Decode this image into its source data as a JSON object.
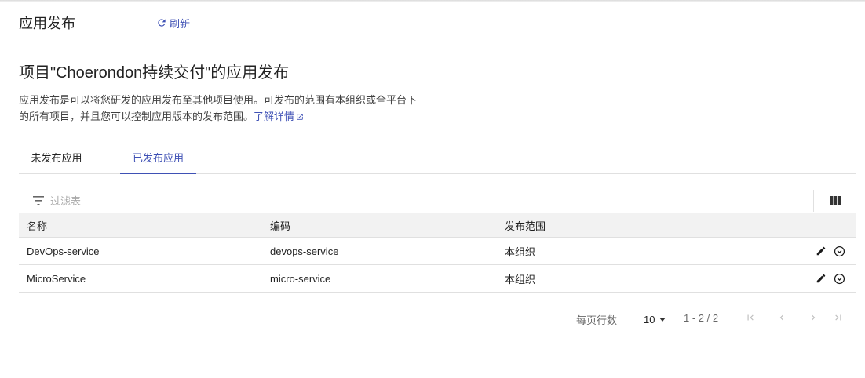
{
  "header": {
    "title": "应用发布",
    "refresh_label": "刷新"
  },
  "intro": {
    "title": "项目\"Choerondon持续交付\"的应用发布",
    "description_line1": "应用发布是可以将您研发的应用发布至其他项目使用。可发布的范围有本组织或全平台下",
    "description_line2": "的所有项目，并且您可以控制应用版本的发布范围。",
    "learn_more": "了解详情"
  },
  "tabs": [
    {
      "label": "未发布应用",
      "active": false
    },
    {
      "label": "已发布应用",
      "active": true
    }
  ],
  "filter": {
    "placeholder": "过滤表",
    "value": ""
  },
  "table": {
    "columns": [
      "名称",
      "编码",
      "发布范围"
    ],
    "rows": [
      {
        "name": "DevOps-service",
        "code": "devops-service",
        "scope": "本组织"
      },
      {
        "name": "MicroService",
        "code": "micro-service",
        "scope": "本组织"
      }
    ]
  },
  "pagination": {
    "rows_per_page_label": "每页行数",
    "rows_per_page": "10",
    "range": "1 - 2 / 2"
  },
  "colors": {
    "accent": "#3f51b5",
    "header_bg": "#f2f2f2",
    "border": "#e0e0e0"
  },
  "icons": {
    "refresh": "refresh-icon",
    "external_link": "external-link-icon",
    "filter": "filter-icon",
    "columns": "view-column-icon",
    "edit": "edit-icon",
    "expand": "expand-circle-icon",
    "first_page": "first-page-icon",
    "prev_page": "chevron-left-icon",
    "next_page": "chevron-right-icon",
    "last_page": "last-page-icon"
  }
}
